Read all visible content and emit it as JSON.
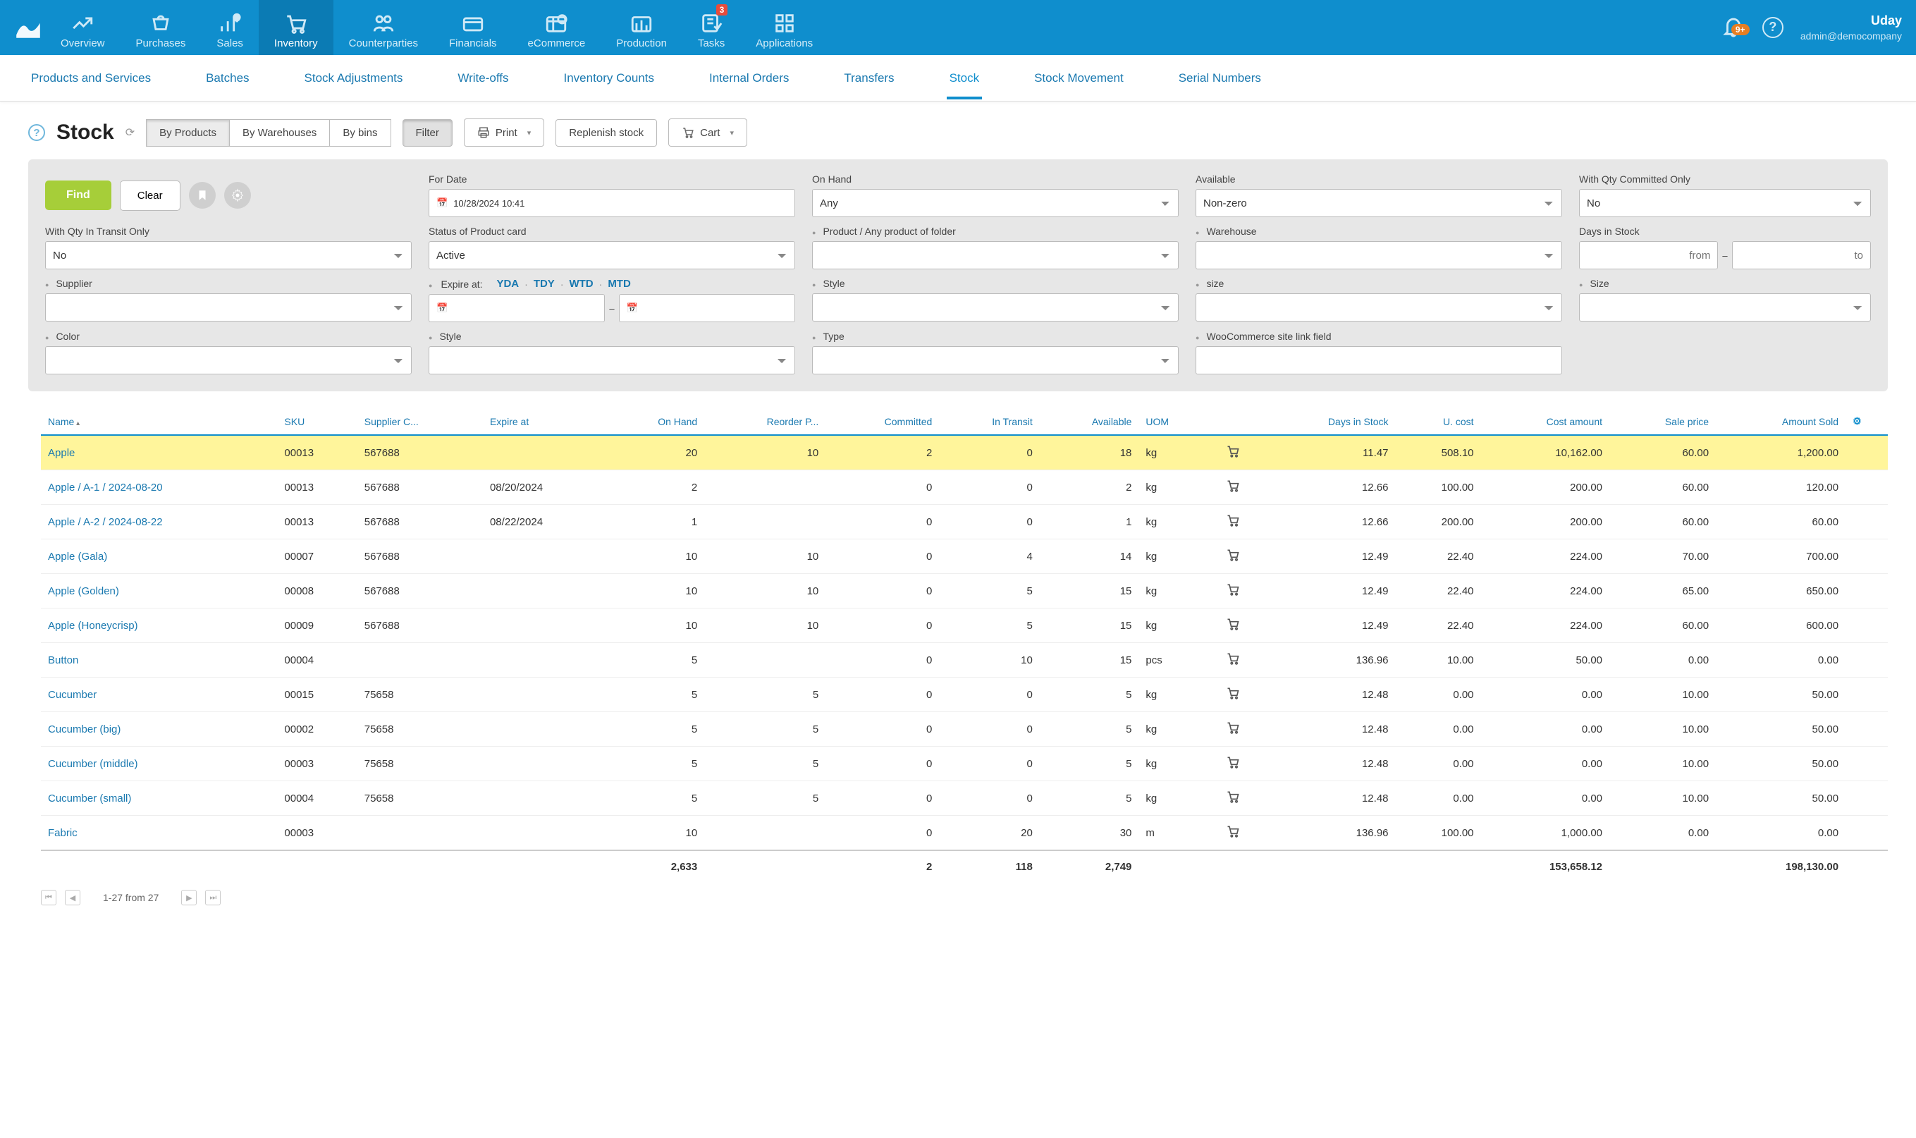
{
  "top_nav": {
    "items": [
      {
        "label": "Overview"
      },
      {
        "label": "Purchases"
      },
      {
        "label": "Sales"
      },
      {
        "label": "Inventory",
        "active": true
      },
      {
        "label": "Counterparties"
      },
      {
        "label": "Financials"
      },
      {
        "label": "eCommerce"
      },
      {
        "label": "Production"
      },
      {
        "label": "Tasks",
        "badge": "3"
      },
      {
        "label": "Applications"
      }
    ],
    "bell_badge": "9+",
    "user_name": "Uday",
    "user_email": "admin@democompany"
  },
  "sub_nav": {
    "items": [
      {
        "label": "Products and Services"
      },
      {
        "label": "Batches"
      },
      {
        "label": "Stock Adjustments"
      },
      {
        "label": "Write-offs"
      },
      {
        "label": "Inventory Counts"
      },
      {
        "label": "Internal Orders"
      },
      {
        "label": "Transfers"
      },
      {
        "label": "Stock",
        "active": true
      },
      {
        "label": "Stock Movement"
      },
      {
        "label": "Serial Numbers"
      }
    ]
  },
  "page": {
    "title": "Stock",
    "segments": [
      {
        "label": "By Products",
        "active": true
      },
      {
        "label": "By Warehouses"
      },
      {
        "label": "By bins"
      }
    ],
    "toolbar": {
      "filter": "Filter",
      "print": "Print",
      "replenish": "Replenish stock",
      "cart": "Cart"
    }
  },
  "filters": {
    "find": "Find",
    "clear": "Clear",
    "for_date": {
      "label": "For Date",
      "value": "10/28/2024 10:41"
    },
    "on_hand": {
      "label": "On Hand",
      "value": "Any"
    },
    "available": {
      "label": "Available",
      "value": "Non-zero"
    },
    "qty_committed": {
      "label": "With Qty Committed Only",
      "value": "No"
    },
    "qty_transit": {
      "label": "With Qty In Transit Only",
      "value": "No"
    },
    "status": {
      "label": "Status of Product card",
      "value": "Active"
    },
    "product": {
      "label": "Product / Any product of folder",
      "value": ""
    },
    "warehouse": {
      "label": "Warehouse",
      "value": ""
    },
    "days_in_stock": {
      "label": "Days in Stock",
      "from": "from",
      "to": "to"
    },
    "supplier": {
      "label": "Supplier",
      "value": ""
    },
    "expire": {
      "label": "Expire at:",
      "links": [
        "YDA",
        "TDY",
        "WTD",
        "MTD"
      ]
    },
    "style1": {
      "label": "Style",
      "value": ""
    },
    "size1": {
      "label": "size",
      "value": ""
    },
    "size2": {
      "label": "Size",
      "value": ""
    },
    "color": {
      "label": "Color",
      "value": ""
    },
    "style2": {
      "label": "Style",
      "value": ""
    },
    "type": {
      "label": "Type",
      "value": ""
    },
    "woo": {
      "label": "WooCommerce site link field",
      "value": ""
    }
  },
  "table": {
    "columns": [
      "Name",
      "SKU",
      "Supplier C...",
      "Expire at",
      "On Hand",
      "Reorder P...",
      "Committed",
      "In Transit",
      "Available",
      "UOM",
      "",
      "Days in Stock",
      "U. cost",
      "Cost amount",
      "Sale price",
      "Amount Sold"
    ],
    "rows": [
      {
        "name": "Apple",
        "sku": "00013",
        "supplier": "567688",
        "expire": "",
        "onhand": "20",
        "reorder": "10",
        "committed": "2",
        "intransit": "0",
        "available": "18",
        "uom": "kg",
        "days": "11.47",
        "ucost": "508.10",
        "costamt": "10,162.00",
        "sale": "60.00",
        "amtsold": "1,200.00"
      },
      {
        "name": "Apple / A-1 / 2024-08-20",
        "sku": "00013",
        "supplier": "567688",
        "expire": "08/20/2024",
        "onhand": "2",
        "reorder": "",
        "committed": "0",
        "intransit": "0",
        "available": "2",
        "uom": "kg",
        "days": "12.66",
        "ucost": "100.00",
        "costamt": "200.00",
        "sale": "60.00",
        "amtsold": "120.00"
      },
      {
        "name": "Apple / A-2 / 2024-08-22",
        "sku": "00013",
        "supplier": "567688",
        "expire": "08/22/2024",
        "onhand": "1",
        "reorder": "",
        "committed": "0",
        "intransit": "0",
        "available": "1",
        "uom": "kg",
        "days": "12.66",
        "ucost": "200.00",
        "costamt": "200.00",
        "sale": "60.00",
        "amtsold": "60.00"
      },
      {
        "name": "Apple (Gala)",
        "sku": "00007",
        "supplier": "567688",
        "expire": "",
        "onhand": "10",
        "reorder": "10",
        "committed": "0",
        "intransit": "4",
        "available": "14",
        "uom": "kg",
        "days": "12.49",
        "ucost": "22.40",
        "costamt": "224.00",
        "sale": "70.00",
        "amtsold": "700.00"
      },
      {
        "name": "Apple (Golden)",
        "sku": "00008",
        "supplier": "567688",
        "expire": "",
        "onhand": "10",
        "reorder": "10",
        "committed": "0",
        "intransit": "5",
        "available": "15",
        "uom": "kg",
        "days": "12.49",
        "ucost": "22.40",
        "costamt": "224.00",
        "sale": "65.00",
        "amtsold": "650.00"
      },
      {
        "name": "Apple (Honeycrisp)",
        "sku": "00009",
        "supplier": "567688",
        "expire": "",
        "onhand": "10",
        "reorder": "10",
        "committed": "0",
        "intransit": "5",
        "available": "15",
        "uom": "kg",
        "days": "12.49",
        "ucost": "22.40",
        "costamt": "224.00",
        "sale": "60.00",
        "amtsold": "600.00"
      },
      {
        "name": "Button",
        "sku": "00004",
        "supplier": "",
        "expire": "",
        "onhand": "5",
        "reorder": "",
        "committed": "0",
        "intransit": "10",
        "available": "15",
        "uom": "pcs",
        "days": "136.96",
        "ucost": "10.00",
        "costamt": "50.00",
        "sale": "0.00",
        "amtsold": "0.00"
      },
      {
        "name": "Cucumber",
        "sku": "00015",
        "supplier": "75658",
        "expire": "",
        "onhand": "5",
        "reorder": "5",
        "committed": "0",
        "intransit": "0",
        "available": "5",
        "uom": "kg",
        "days": "12.48",
        "ucost": "0.00",
        "costamt": "0.00",
        "sale": "10.00",
        "amtsold": "50.00"
      },
      {
        "name": "Cucumber (big)",
        "sku": "00002",
        "supplier": "75658",
        "expire": "",
        "onhand": "5",
        "reorder": "5",
        "committed": "0",
        "intransit": "0",
        "available": "5",
        "uom": "kg",
        "days": "12.48",
        "ucost": "0.00",
        "costamt": "0.00",
        "sale": "10.00",
        "amtsold": "50.00"
      },
      {
        "name": "Cucumber (middle)",
        "sku": "00003",
        "supplier": "75658",
        "expire": "",
        "onhand": "5",
        "reorder": "5",
        "committed": "0",
        "intransit": "0",
        "available": "5",
        "uom": "kg",
        "days": "12.48",
        "ucost": "0.00",
        "costamt": "0.00",
        "sale": "10.00",
        "amtsold": "50.00"
      },
      {
        "name": "Cucumber (small)",
        "sku": "00004",
        "supplier": "75658",
        "expire": "",
        "onhand": "5",
        "reorder": "5",
        "committed": "0",
        "intransit": "0",
        "available": "5",
        "uom": "kg",
        "days": "12.48",
        "ucost": "0.00",
        "costamt": "0.00",
        "sale": "10.00",
        "amtsold": "50.00"
      },
      {
        "name": "Fabric",
        "sku": "00003",
        "supplier": "",
        "expire": "",
        "onhand": "10",
        "reorder": "",
        "committed": "0",
        "intransit": "20",
        "available": "30",
        "uom": "m",
        "days": "136.96",
        "ucost": "100.00",
        "costamt": "1,000.00",
        "sale": "0.00",
        "amtsold": "0.00"
      }
    ],
    "totals": {
      "onhand": "2,633",
      "committed": "2",
      "intransit": "118",
      "available": "2,749",
      "costamt": "153,658.12",
      "amtsold": "198,130.00"
    },
    "pager": "1-27 from 27"
  }
}
